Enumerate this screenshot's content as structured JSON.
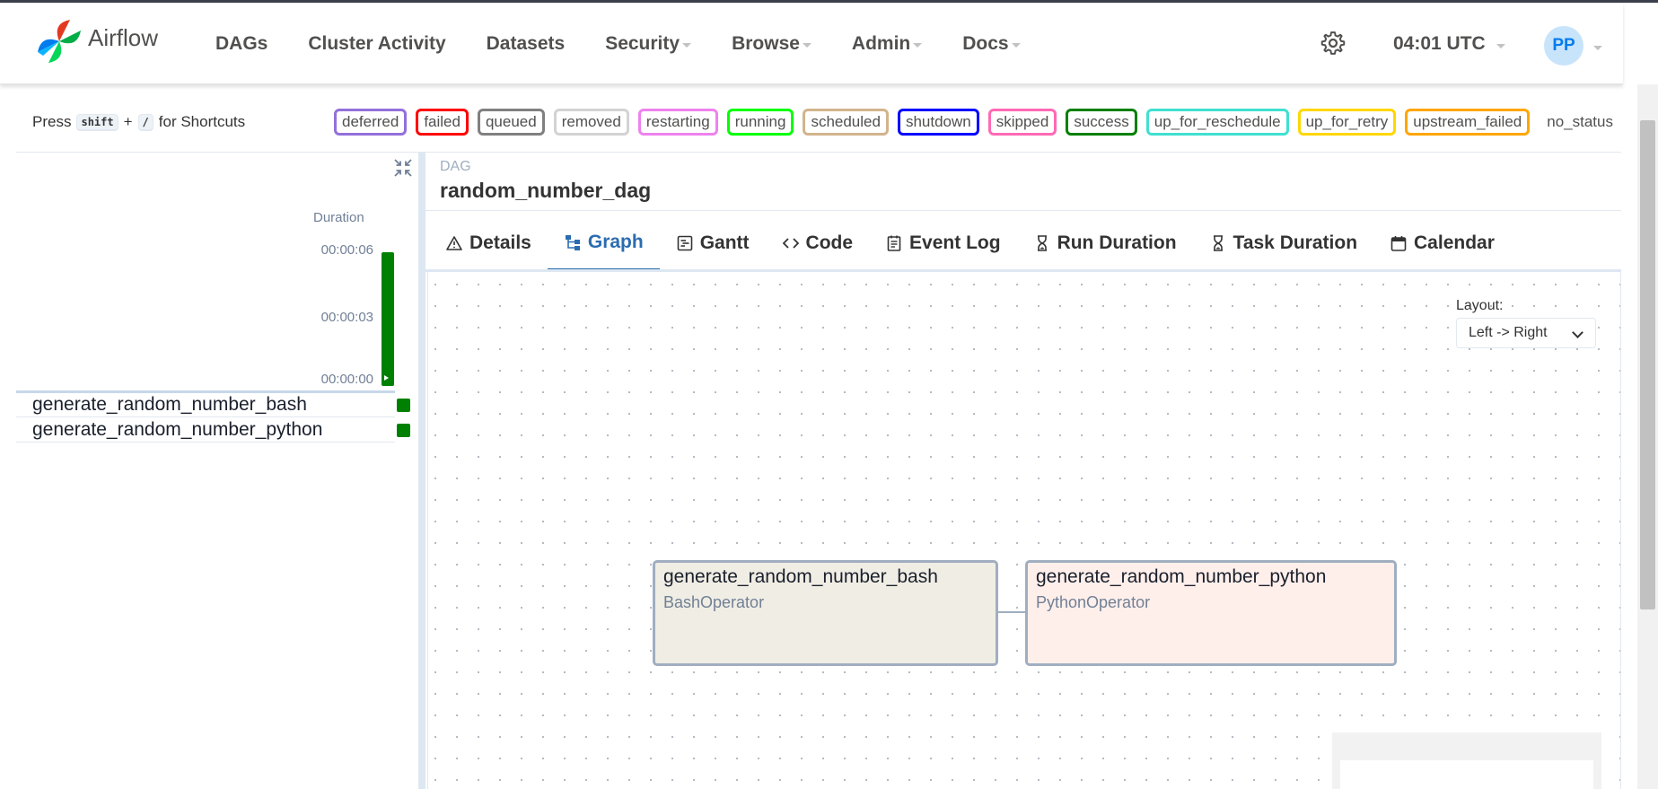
{
  "navbar": {
    "brand": "Airflow",
    "items": [
      {
        "label": "DAGs",
        "dropdown": false
      },
      {
        "label": "Cluster Activity",
        "dropdown": false
      },
      {
        "label": "Datasets",
        "dropdown": false
      },
      {
        "label": "Security",
        "dropdown": true
      },
      {
        "label": "Browse",
        "dropdown": true
      },
      {
        "label": "Admin",
        "dropdown": true
      },
      {
        "label": "Docs",
        "dropdown": true
      }
    ],
    "time": "04:01 UTC",
    "user_initials": "PP"
  },
  "shortcuts": {
    "press": "Press",
    "key1": "shift",
    "plus": "+",
    "key2": "/",
    "suffix": "for Shortcuts"
  },
  "legend": [
    {
      "label": "deferred",
      "color": "#9370db"
    },
    {
      "label": "failed",
      "color": "#ff0000"
    },
    {
      "label": "queued",
      "color": "#808080"
    },
    {
      "label": "removed",
      "color": "#d3d3d3"
    },
    {
      "label": "restarting",
      "color": "#ee82ee"
    },
    {
      "label": "running",
      "color": "#00ff00"
    },
    {
      "label": "scheduled",
      "color": "#d2b48c"
    },
    {
      "label": "shutdown",
      "color": "#0000ff"
    },
    {
      "label": "skipped",
      "color": "#ff69b4"
    },
    {
      "label": "success",
      "color": "#008000"
    },
    {
      "label": "up_for_reschedule",
      "color": "#40e0d0"
    },
    {
      "label": "up_for_retry",
      "color": "#ffd700"
    },
    {
      "label": "upstream_failed",
      "color": "#ffa500"
    },
    {
      "label": "no_status",
      "color": "none"
    }
  ],
  "grid": {
    "duration_title": "Duration",
    "ticks": [
      "00:00:06",
      "00:00:03",
      "00:00:00"
    ],
    "run_status_color": "#008000",
    "tasks": [
      {
        "name": "generate_random_number_bash",
        "status": "success"
      },
      {
        "name": "generate_random_number_python",
        "status": "success"
      }
    ]
  },
  "dag": {
    "label": "DAG",
    "id": "random_number_dag"
  },
  "tabs": [
    {
      "label": "Details",
      "icon": "warning-icon",
      "active": false
    },
    {
      "label": "Graph",
      "icon": "graph-icon",
      "active": true
    },
    {
      "label": "Gantt",
      "icon": "gantt-icon",
      "active": false
    },
    {
      "label": "Code",
      "icon": "code-icon",
      "active": false
    },
    {
      "label": "Event Log",
      "icon": "event-log-icon",
      "active": false
    },
    {
      "label": "Run Duration",
      "icon": "hourglass-icon",
      "active": false
    },
    {
      "label": "Task Duration",
      "icon": "hourglass-icon",
      "active": false
    },
    {
      "label": "Calendar",
      "icon": "calendar-icon",
      "active": false
    }
  ],
  "graph": {
    "layout_label": "Layout:",
    "layout_value": "Left -> Right",
    "nodes": [
      {
        "title": "generate_random_number_bash",
        "operator": "BashOperator",
        "color": "#f0ede4"
      },
      {
        "title": "generate_random_number_python",
        "operator": "PythonOperator",
        "color": "#ffefeb"
      }
    ]
  }
}
